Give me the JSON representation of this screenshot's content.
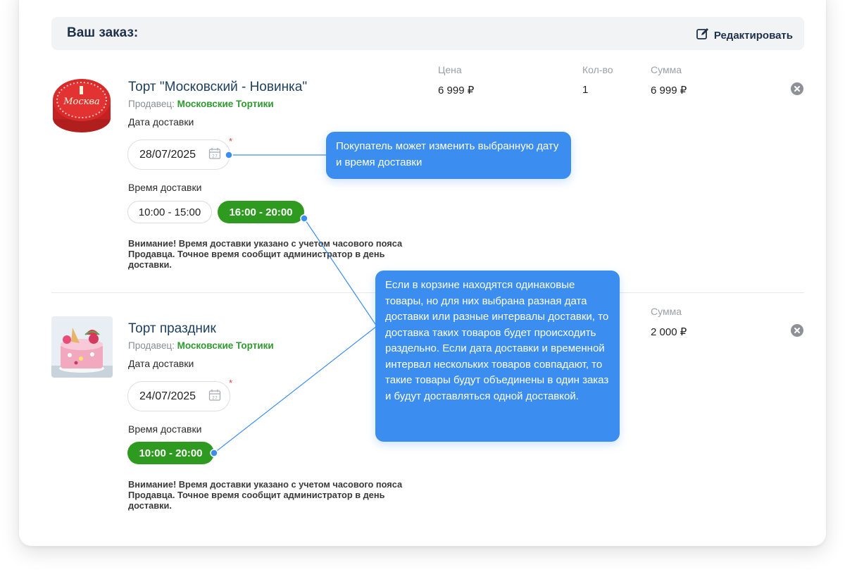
{
  "order": {
    "title": "Ваш заказ:",
    "edit_label": "Редактировать"
  },
  "columns": {
    "price": "Цена",
    "qty": "Кол-во",
    "sum": "Сумма"
  },
  "items": [
    {
      "name": "Торт \"Московский - Новинка\"",
      "seller_prefix": "Продавец:",
      "seller": "Московские Тортики",
      "date_label": "Дата доставки",
      "date": "28/07/2025",
      "time_label": "Время доставки",
      "times": [
        "10:00 - 15:00",
        "16:00 - 20:00"
      ],
      "selected_time": "16:00 - 20:00",
      "price": "6 999 ₽",
      "qty": "1",
      "sum": "6 999 ₽",
      "cake_text": "Москва",
      "notice": "Внимание! Время доставки указано с учетом часового пояса Продавца. Точное время сообщит администратор в день доставки."
    },
    {
      "name": "Торт праздник",
      "seller_prefix": "Продавец:",
      "seller": "Московские Тортики",
      "date_label": "Дата доставки",
      "date": "24/07/2025",
      "time_label": "Время доставки",
      "times": [
        "10:00 - 20:00"
      ],
      "selected_time": "10:00 - 20:00",
      "sum": "2 000 ₽",
      "notice": "Внимание! Время доставки указано с учетом часового пояса Продавца. Точное время сообщит администратор в день доставки."
    }
  ],
  "tooltips": {
    "first": "Покупатель может изменить выбранную дату и время доставки",
    "second": "Если в корзине находятся одинаковые товары, но для них выбрана разная дата доставки или разные интервалы доставки, то доставка таких товаров будет происходить раздельно. Если дата доставки и временной интервал нескольких товаров совпадают, то такие товары будут объединены в один заказ и будут доставляться одной доставкой."
  },
  "colors": {
    "accent_green": "#2f9a20",
    "tooltip_blue": "#3b8ef0",
    "title_navy": "#1d3149"
  }
}
